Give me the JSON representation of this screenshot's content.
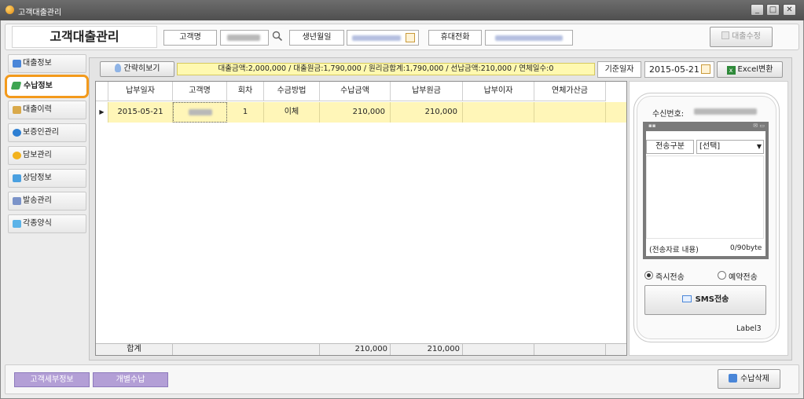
{
  "window": {
    "title": "고객대출관리",
    "minimize": "_",
    "maximize": "□",
    "close": "✕"
  },
  "header": {
    "app_title": "고객대출관리",
    "customer_name_label": "고객명",
    "birth_label": "생년월일",
    "mobile_label": "휴대전화",
    "loan_edit_button": "대출수정"
  },
  "sidebar": {
    "items": [
      {
        "label": "대출정보",
        "icon": "monitor-icon",
        "color": "#4a86d8"
      },
      {
        "label": "수납정보",
        "icon": "edit-icon",
        "color": "#3ea552"
      },
      {
        "label": "대출이력",
        "icon": "document-icon",
        "color": "#d9a94a"
      },
      {
        "label": "보증인관리",
        "icon": "globe-icon",
        "color": "#2d7fd3"
      },
      {
        "label": "담보관리",
        "icon": "sun-icon",
        "color": "#f2b21d"
      },
      {
        "label": "상담정보",
        "icon": "chat-icon",
        "color": "#4aa0e0"
      },
      {
        "label": "발송관리",
        "icon": "mail-icon",
        "color": "#7b93c9"
      },
      {
        "label": "각종양식",
        "icon": "forms-icon",
        "color": "#5cb3e8"
      }
    ]
  },
  "toolbar": {
    "brief_view_button": "간략히보기",
    "summary": "대출금액:2,000,000 / 대출원금:1,790,000 / 원리금합계:1,790,000 / 선납금액:210,000 / 연체일수:0",
    "base_date_label": "기준일자",
    "base_date_value": "2015-05-21",
    "excel_button": "Excel변환"
  },
  "grid": {
    "columns": [
      "납부일자",
      "고객명",
      "회차",
      "수금방법",
      "수납금액",
      "납부원금",
      "납부이자",
      "연체가산금"
    ],
    "rows": [
      {
        "date": "2015-05-21",
        "seq": "1",
        "method": "이체",
        "amount": "210,000",
        "principal": "210,000",
        "interest": "",
        "penalty": ""
      }
    ],
    "footer": {
      "label": "합계",
      "amount": "210,000",
      "principal": "210,000"
    }
  },
  "sms": {
    "receiver_label": "수신번호:",
    "type_label": "전송구분",
    "type_select": "[선택]",
    "content_label": "(전송자료 내용)",
    "byte_count": "0/90byte",
    "radio_immediate": "즉시전송",
    "radio_reserve": "예약전송",
    "send_button": "SMS전송",
    "label3": "Label3"
  },
  "footer": {
    "customer_detail_button": "고객세부정보",
    "individual_payment_button": "개별수납",
    "delete_payment_button": "수납삭제"
  }
}
